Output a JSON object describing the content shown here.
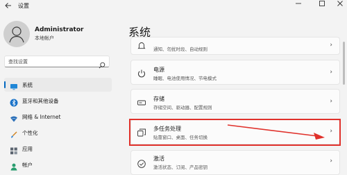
{
  "window": {
    "title": "设置",
    "back_icon": "back-arrow-icon",
    "controls": [
      "minimize-icon",
      "maximize-icon",
      "close-icon"
    ]
  },
  "profile": {
    "name": "Administrator",
    "account_type": "本地帐户"
  },
  "search": {
    "placeholder": "查找设置"
  },
  "sidebar": {
    "items": [
      {
        "label": "系统",
        "icon": "monitor-icon",
        "active": true
      },
      {
        "label": "蓝牙和其他设备",
        "icon": "bluetooth-icon"
      },
      {
        "label": "网络 & Internet",
        "icon": "network-icon"
      },
      {
        "label": "个性化",
        "icon": "brush-icon"
      },
      {
        "label": "应用",
        "icon": "apps-icon"
      },
      {
        "label": "帐户",
        "icon": "account-icon"
      }
    ]
  },
  "main": {
    "title": "系统",
    "cards": [
      {
        "title": "",
        "subtitle": "通知、勿扰时段、自动规则",
        "icon": "notification-icon"
      },
      {
        "title": "电源",
        "subtitle": "睡眠、电池使用情况、节电模式",
        "icon": "power-icon"
      },
      {
        "title": "存储",
        "subtitle": "存储空间、驱动器、配置规则",
        "icon": "storage-icon"
      },
      {
        "title": "多任务处理",
        "subtitle": "贴靠窗口、桌面、任务切换",
        "icon": "multitasking-icon",
        "highlighted": true
      },
      {
        "title": "激活",
        "subtitle": "激活状态、订阅、产品密钥",
        "icon": "activation-icon"
      }
    ]
  },
  "annotation": {
    "color": "#e0312b"
  },
  "colors": {
    "accent": "#0067c0",
    "background": "#f3f3f3",
    "card": "#fbfbfb"
  }
}
